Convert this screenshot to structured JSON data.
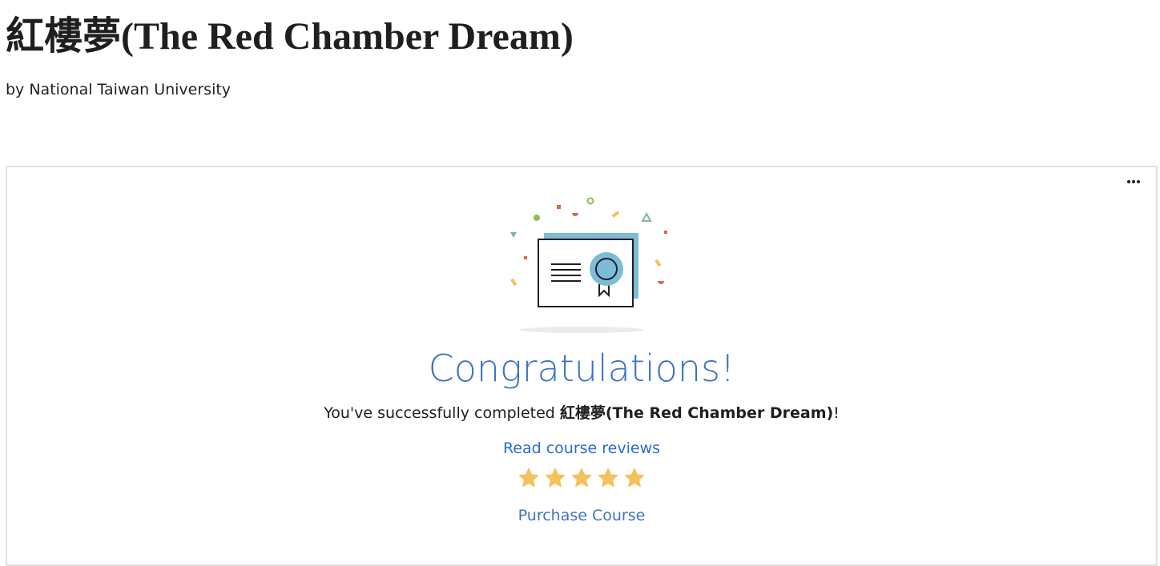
{
  "page": {
    "course_title": "紅樓夢(The Red Chamber Dream)",
    "provider_line": "by National Taiwan University"
  },
  "card": {
    "heading": "Congratulations!",
    "message_prefix": "You've successfully completed ",
    "message_course": "紅樓夢(The Red Chamber Dream)",
    "message_suffix": "!",
    "reviews_link": "Read course reviews",
    "rating_stars": 5,
    "purchase_link": "Purchase Course"
  },
  "icons": {
    "more_menu": "more-horizontal-icon",
    "illustration": "certificate-icon",
    "star": "star-icon"
  },
  "colors": {
    "accent_blue": "#3d73c0",
    "link_blue": "#2a6bd4",
    "star_yellow": "#f5c15b",
    "certificate_blue": "#7cbcd9",
    "border_grey": "#e1e1e1"
  }
}
